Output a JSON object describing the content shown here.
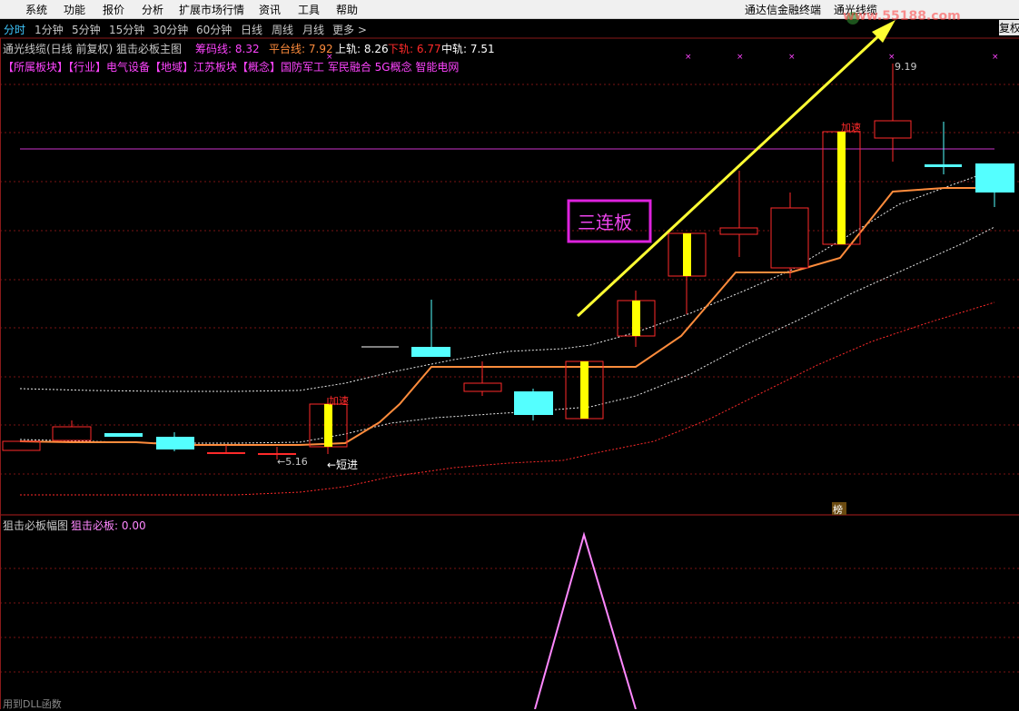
{
  "menu": {
    "items": [
      "系统",
      "功能",
      "报价",
      "分析",
      "扩展市场行情",
      "资讯",
      "工具",
      "帮助"
    ],
    "right_items": [
      "通达信金融终端",
      "通光线缆"
    ]
  },
  "periods": {
    "items": [
      "分时",
      "1分钟",
      "5分钟",
      "15分钟",
      "30分钟",
      "60分钟",
      "日线",
      "周线",
      "月线",
      "更多 >"
    ],
    "active": "分时",
    "restore_label": "复权"
  },
  "watermark": "www.55188.com",
  "main_chart": {
    "title": "通光线缆(日线 前复权) 狙击必板主图",
    "indicators": [
      {
        "label": "筹码线",
        "value": "8.32",
        "color": "#ff44ff"
      },
      {
        "label": "平台线",
        "value": "7.92",
        "color": "#ff8c3c"
      },
      {
        "label": "上轨",
        "value": "8.26",
        "color": "#ffffff"
      },
      {
        "label": "下轨",
        "value": "6.77",
        "color": "#ff2a2a"
      },
      {
        "label": "中轨",
        "value": "7.51",
        "color": "#ffffff"
      }
    ],
    "sectors": "【所属板块】【行业】电气设备【地域】江苏板块【概念】国防军工 军民融合 5G概念 智能电网",
    "annotations": {
      "accel_1": "加速",
      "accel_2": "加速",
      "short_entry": "←短进",
      "low_label": "←5.16",
      "high_label": "9.19",
      "boxed_label": "三连板",
      "rank_badge": "榜"
    },
    "colors": {
      "up_candle": "#ff2a2a",
      "down_candle": "#54ffff",
      "limit_up_body": "#ffff00",
      "platform_line": "#ff8c3c",
      "chip_line": "#cc33cc",
      "arrow": "#ffff33"
    }
  },
  "sub_chart": {
    "title": "狙击必板幅图",
    "indicator_label": "狙击必板",
    "indicator_value": "0.00",
    "footer": "用到DLL函数"
  }
}
